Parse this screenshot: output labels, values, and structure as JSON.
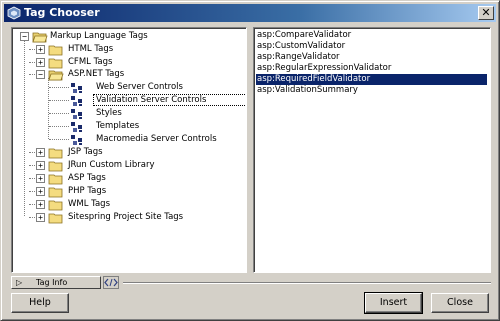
{
  "window": {
    "title": "Tag Chooser",
    "close_glyph": "✕"
  },
  "tree": {
    "root": {
      "label": "Markup Language Tags",
      "expander": "−",
      "icon": "folder-open-icon"
    },
    "items": [
      {
        "label": "HTML Tags",
        "expander": "+",
        "icon": "folder-icon"
      },
      {
        "label": "CFML Tags",
        "expander": "+",
        "icon": "folder-icon"
      },
      {
        "label": "ASP.NET Tags",
        "expander": "−",
        "icon": "folder-open-icon"
      },
      {
        "label": "Web Server Controls",
        "icon": "tag-library-icon"
      },
      {
        "label": "Validation Server Controls",
        "icon": "tag-library-icon"
      },
      {
        "label": "Styles",
        "icon": "tag-library-icon"
      },
      {
        "label": "Templates",
        "icon": "tag-library-icon"
      },
      {
        "label": "Macromedia Server Controls",
        "icon": "tag-library-icon"
      },
      {
        "label": "JSP Tags",
        "expander": "+",
        "icon": "folder-icon"
      },
      {
        "label": "JRun Custom Library",
        "expander": "+",
        "icon": "folder-icon"
      },
      {
        "label": "ASP Tags",
        "expander": "+",
        "icon": "folder-icon"
      },
      {
        "label": "PHP Tags",
        "expander": "+",
        "icon": "folder-icon"
      },
      {
        "label": "WML Tags",
        "expander": "+",
        "icon": "folder-icon"
      },
      {
        "label": "Sitespring Project Site Tags",
        "expander": "+",
        "icon": "folder-icon"
      }
    ],
    "selected_label": "Validation Server Controls"
  },
  "tag_list": {
    "items": [
      "asp:CompareValidator",
      "asp:CustomValidator",
      "asp:RangeValidator",
      "asp:RegularExpressionValidator",
      "asp:RequiredFieldValidator",
      "asp:ValidationSummary"
    ],
    "selected": "asp:RequiredFieldValidator"
  },
  "tag_info": {
    "arrow": "▷",
    "label": "Tag Info",
    "icon": "tag-brackets-icon"
  },
  "buttons": {
    "help": "Help",
    "insert": "Insert",
    "close": "Close"
  },
  "colors": {
    "title_bar": "#0a246a",
    "selection": "#0a246a",
    "dialog_bg": "#d4d0c8"
  }
}
